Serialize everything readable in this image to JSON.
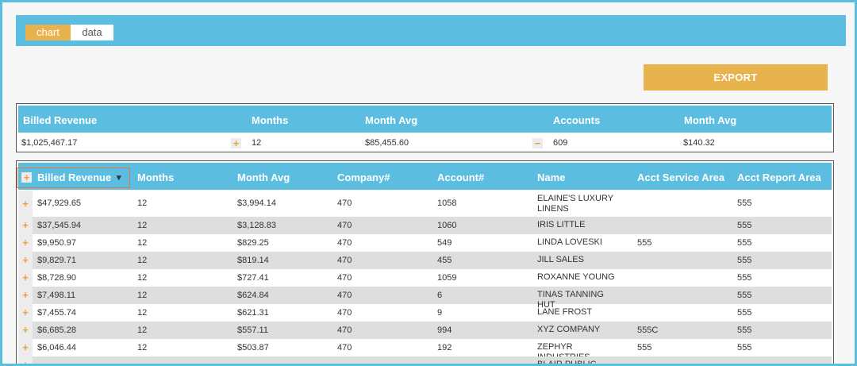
{
  "tabs": [
    {
      "label": "chart",
      "active": true
    },
    {
      "label": "data",
      "active": false
    }
  ],
  "export_label": "EXPORT",
  "summary": {
    "headers": [
      "Billed Revenue",
      "Months",
      "Month Avg",
      "Accounts",
      "Month Avg"
    ],
    "values": [
      "$1,025,467.17",
      "12",
      "$85,455.60",
      "609",
      "$140.32"
    ],
    "expand_symbol": "+",
    "collapse_symbol": "−"
  },
  "grid": {
    "headers": [
      "Billed Revenue",
      "Months",
      "Month Avg",
      "Company#",
      "Account#",
      "Name",
      "Acct Service Area",
      "Acct Report Area"
    ],
    "sort_arrow": "▾",
    "expand_symbol": "+",
    "rows": [
      [
        "$47,929.65",
        "12",
        "$3,994.14",
        "470",
        "1058",
        "ELAINE'S LUXURY LINENS",
        "",
        "555"
      ],
      [
        "$37,545.94",
        "12",
        "$3,128.83",
        "470",
        "1060",
        "IRIS LITTLE",
        "",
        "555"
      ],
      [
        "$9,950.97",
        "12",
        "$829.25",
        "470",
        "549",
        "LINDA LOVESKI",
        "555",
        "555"
      ],
      [
        "$9,829.71",
        "12",
        "$819.14",
        "470",
        "455",
        "JILL SALES",
        "",
        "555"
      ],
      [
        "$8,728.90",
        "12",
        "$727.41",
        "470",
        "1059",
        "ROXANNE YOUNG",
        "",
        "555"
      ],
      [
        "$7,498.11",
        "12",
        "$624.84",
        "470",
        "6",
        "TINAS TANNING HUT",
        "",
        "555"
      ],
      [
        "$7,455.74",
        "12",
        "$621.31",
        "470",
        "9",
        "LANE FROST",
        "",
        "555"
      ],
      [
        "$6,685.28",
        "12",
        "$557.11",
        "470",
        "994",
        "XYZ COMPANY",
        "555C",
        "555"
      ],
      [
        "$6,046.44",
        "12",
        "$503.87",
        "470",
        "192",
        "ZEPHYR INDUSTRIES",
        "555",
        "555"
      ],
      [
        "",
        "",
        "",
        "",
        "",
        "BLAIR PUBLIC",
        "",
        ""
      ]
    ]
  },
  "colors": {
    "accent_blue": "#5bbde0",
    "accent_orange": "#e8b24c",
    "sort_outline": "#e27a3f"
  }
}
